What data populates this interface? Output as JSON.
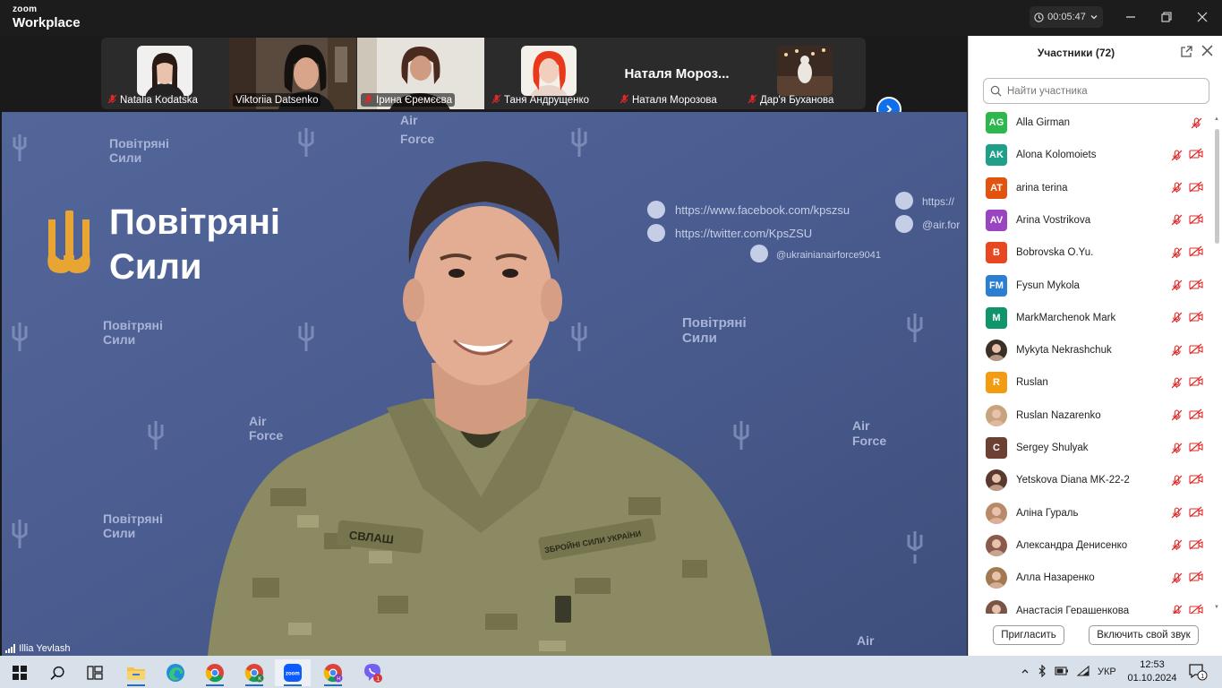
{
  "window": {
    "brand_top": "zoom",
    "brand_bottom": "Workplace",
    "timer": "00:05:47"
  },
  "gallery": [
    {
      "name": "Natalia Kodatska",
      "muted": true,
      "video": false
    },
    {
      "name": "Viktoriia Datsenko",
      "muted": false,
      "video": true
    },
    {
      "name": "Ірина Єремєєва",
      "muted": true,
      "video": true
    },
    {
      "name": "Таня Андрущенко",
      "muted": true,
      "video": false
    },
    {
      "name": "Наталя Морозова",
      "muted": true,
      "video": false,
      "big_name": "Наталя Мороз..."
    },
    {
      "name": "Дар'я Буханова",
      "muted": true,
      "video": false
    }
  ],
  "main_video": {
    "speaker": "Illia Yevlash",
    "backdrop": {
      "title_line1": "Повітряні",
      "title_line2": "Сили",
      "small1": "Повітряні",
      "small2": "Сили",
      "airforce1": "Air",
      "airforce2": "Force",
      "facebook": "https://www.facebook.com/kpszsu",
      "twitter": "https://twitter.com/KpsZSU",
      "instagram": "@ukrainianairforce9041",
      "telegram": "https://",
      "insta2": "@air.for",
      "patch1": "СВЛАШ",
      "patch2": "ЗБРОЙНІ СИЛИ УКРАЇНИ"
    }
  },
  "panel": {
    "title": "Участники (72)",
    "search_placeholder": "Найти участника",
    "invite_label": "Пригласить",
    "unmute_label": "Включить свой звук",
    "participants": [
      {
        "name": "Alla Girman",
        "initials": "AG",
        "color": "#2db84d",
        "cam_icon": false
      },
      {
        "name": "Alona Kolomoiets",
        "initials": "AK",
        "color": "#1f9e8a",
        "cam_icon": true
      },
      {
        "name": "arina terina",
        "initials": "AT",
        "color": "#e2530f",
        "cam_icon": true
      },
      {
        "name": "Arina Vostrikova",
        "initials": "AV",
        "color": "#9b44c2",
        "cam_icon": true
      },
      {
        "name": "Bobrovska O.Yu.",
        "initials": "B",
        "color": "#e8481f",
        "cam_icon": true
      },
      {
        "name": "Fysun Mykola",
        "initials": "FM",
        "color": "#2a7fd1",
        "cam_icon": true
      },
      {
        "name": "MarkMarchenok Mark",
        "initials": "M",
        "color": "#10946b",
        "cam_icon": true
      },
      {
        "name": "Mykyta Nekrashchuk",
        "initials": "",
        "color": "#3b3026",
        "cam_icon": true
      },
      {
        "name": "Ruslan",
        "initials": "R",
        "color": "#f39c12",
        "cam_icon": true
      },
      {
        "name": "Ruslan Nazarenko",
        "initials": "",
        "color": "#c9a27e",
        "cam_icon": true
      },
      {
        "name": "Sergey Shulyak",
        "initials": "C",
        "color": "#6d4034",
        "cam_icon": true
      },
      {
        "name": "Yetskova Diana MK-22-2",
        "initials": "",
        "color": "#5a3a2e",
        "cam_icon": true
      },
      {
        "name": "Аліна Гураль",
        "initials": "",
        "color": "#b98a6a",
        "cam_icon": true
      },
      {
        "name": "Александра Денисенко",
        "initials": "",
        "color": "#8a5a4a",
        "cam_icon": true
      },
      {
        "name": "Алла Назаренко",
        "initials": "",
        "color": "#a27a52",
        "cam_icon": true
      },
      {
        "name": "Анастасія Геращенкова",
        "initials": "",
        "color": "#7a5444",
        "cam_icon": true
      }
    ]
  },
  "taskbar": {
    "lang": "УКР",
    "time": "12:53",
    "date": "01.10.2024",
    "notif_count": "1",
    "viber_badge": "1",
    "zoom_label": "zoom",
    "chrome_k": "K",
    "chrome_h": "H"
  }
}
